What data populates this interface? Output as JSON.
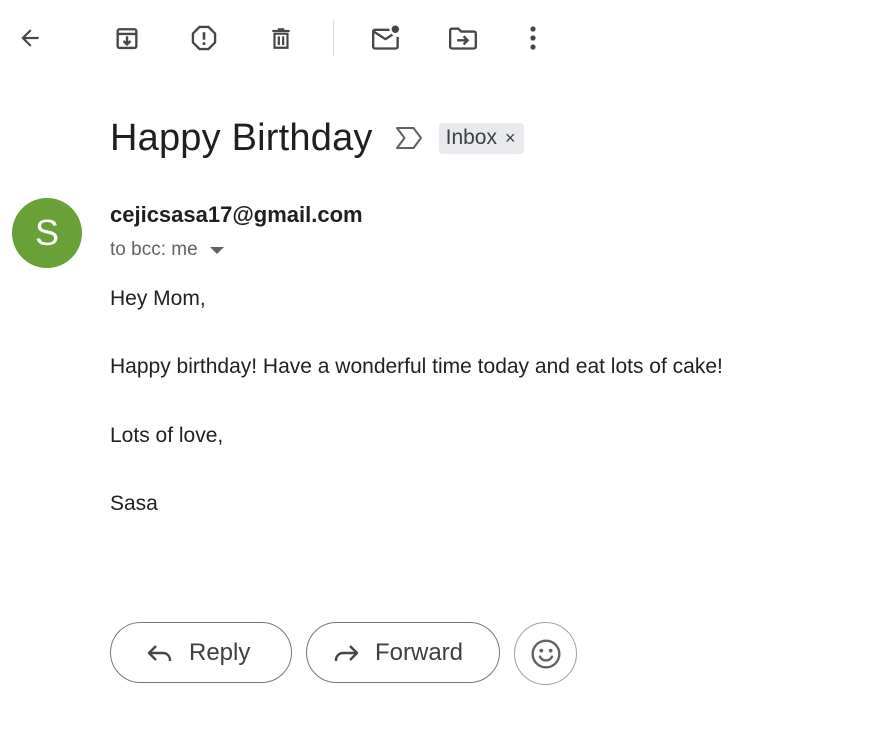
{
  "toolbar": {
    "icons": [
      "back-arrow-icon",
      "archive-icon",
      "report-spam-icon",
      "delete-icon",
      "mark-unread-icon",
      "move-to-icon",
      "more-options-icon"
    ]
  },
  "email": {
    "subject": "Happy Birthday",
    "label": "Inbox",
    "label_close": "×",
    "sender_initial": "S",
    "sender": "cejicsasa17@gmail.com",
    "recipients": "to bcc: me",
    "body": [
      "Hey Mom,",
      "Happy birthday! Have a wonderful time today and eat lots of cake!",
      "Lots of love,",
      "Sasa"
    ]
  },
  "actions": {
    "reply_label": "Reply",
    "forward_label": "Forward"
  },
  "colors": {
    "avatar_bg": "#6aa038",
    "chip_bg": "#e8eaed",
    "icon_gray": "#444746"
  }
}
